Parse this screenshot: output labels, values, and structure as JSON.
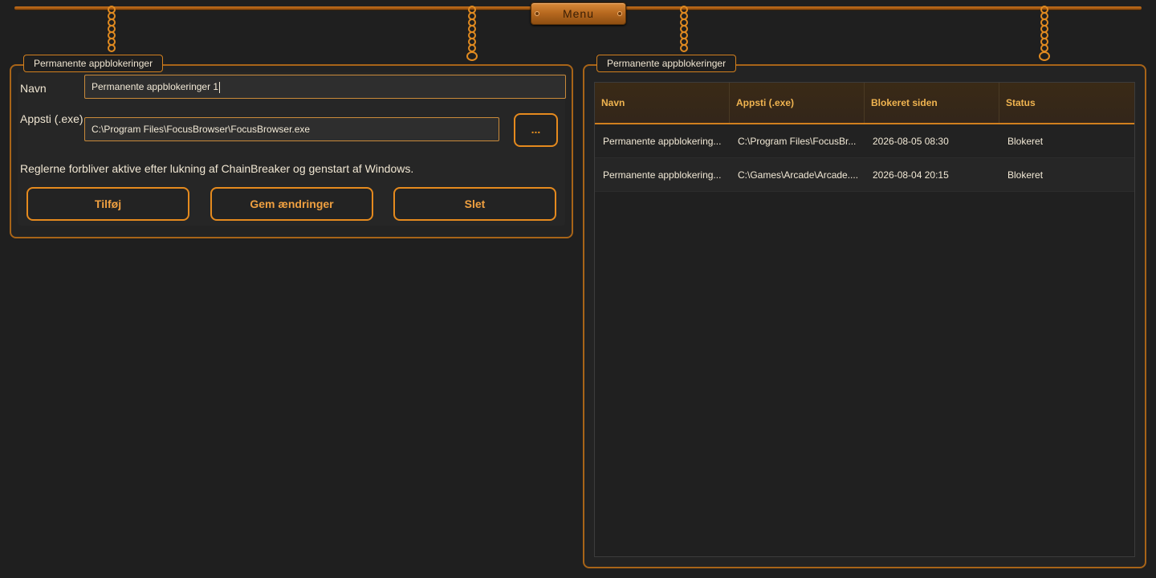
{
  "menu": {
    "label": "Menu"
  },
  "form_panel": {
    "title": "Permanente appblokeringer",
    "name_label": "Navn",
    "name_value": "Permanente appblokeringer 1",
    "path_label": "Appsti (.exe)",
    "path_value": "C:\\Program Files\\FocusBrowser\\FocusBrowser.exe",
    "browse_label": "...",
    "note": "Reglerne forbliver aktive efter lukning af ChainBreaker og genstart af Windows.",
    "buttons": {
      "add": "Tilføj",
      "save": "Gem ændringer",
      "delete": "Slet"
    }
  },
  "list_panel": {
    "title": "Permanente appblokeringer",
    "columns": [
      "Navn",
      "Appsti (.exe)",
      "Blokeret siden",
      "Status"
    ],
    "rows": [
      {
        "name": "Permanente appblokering...",
        "path": "C:\\Program Files\\FocusBr...",
        "since": "2026-08-05 08:30",
        "status": "Blokeret"
      },
      {
        "name": "Permanente appblokering...",
        "path": "C:\\Games\\Arcade\\Arcade....",
        "since": "2026-08-04 20:15",
        "status": "Blokeret"
      }
    ]
  },
  "colors": {
    "accent": "#e58a1e",
    "background": "#1f1f1f",
    "header_text": "#f0b450"
  }
}
